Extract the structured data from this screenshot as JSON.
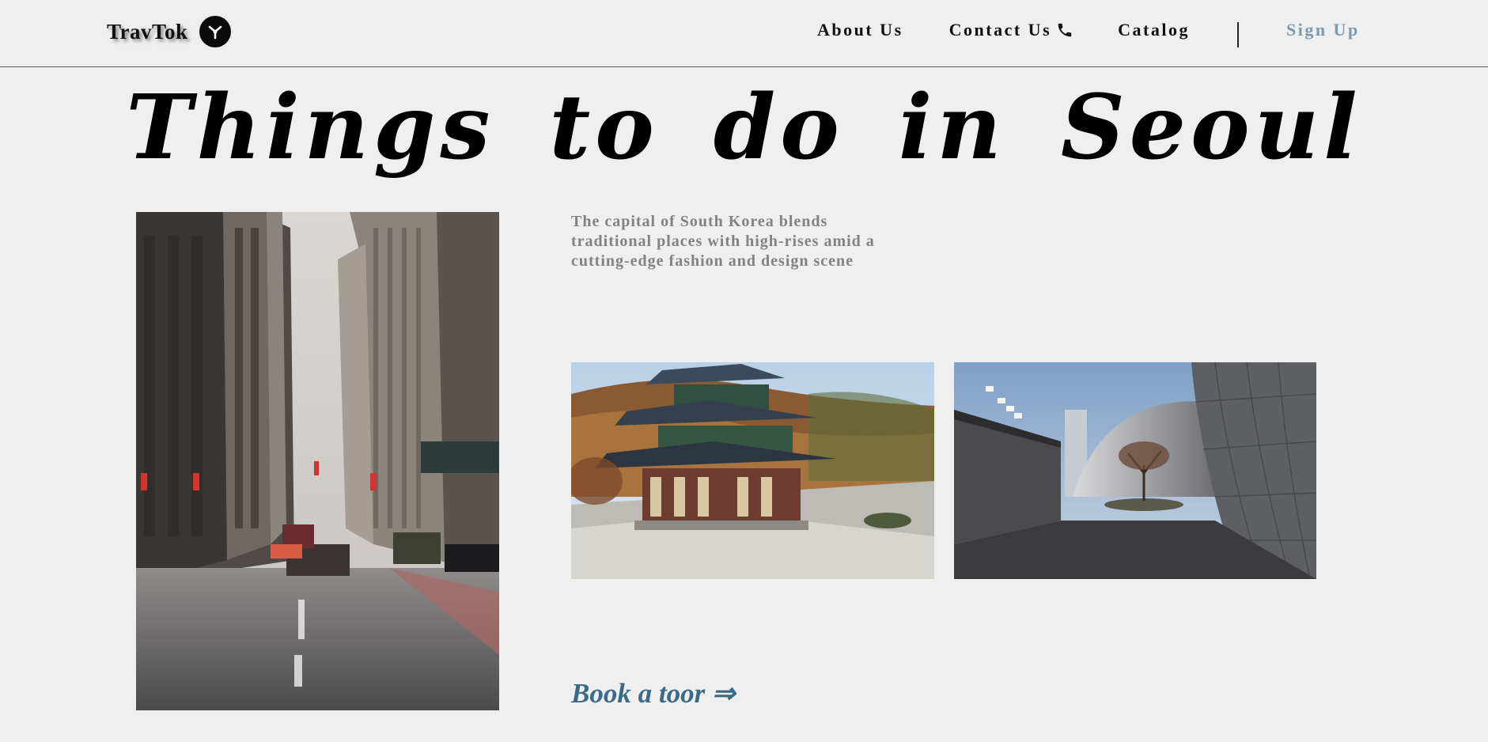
{
  "navbar": {
    "brand_name": "TravTok",
    "brand_logo_icon": "y-fork-logo-icon",
    "links": {
      "about": "About Us",
      "contact": "Contact Us",
      "catalog": "Catalog",
      "signup": "Sign Up"
    },
    "contact_icon": "phone-icon"
  },
  "hero": {
    "title": "Things to do in Seoul"
  },
  "content": {
    "description": "The capital of South Korea blends traditional places with high-rises amid a cutting-edge fashion and design scene",
    "book_link": "Book a toor ⇒"
  },
  "colors": {
    "background": "#efefef",
    "signup": "#7e98ad",
    "description": "#828282",
    "book_link": "#3b6a89"
  }
}
